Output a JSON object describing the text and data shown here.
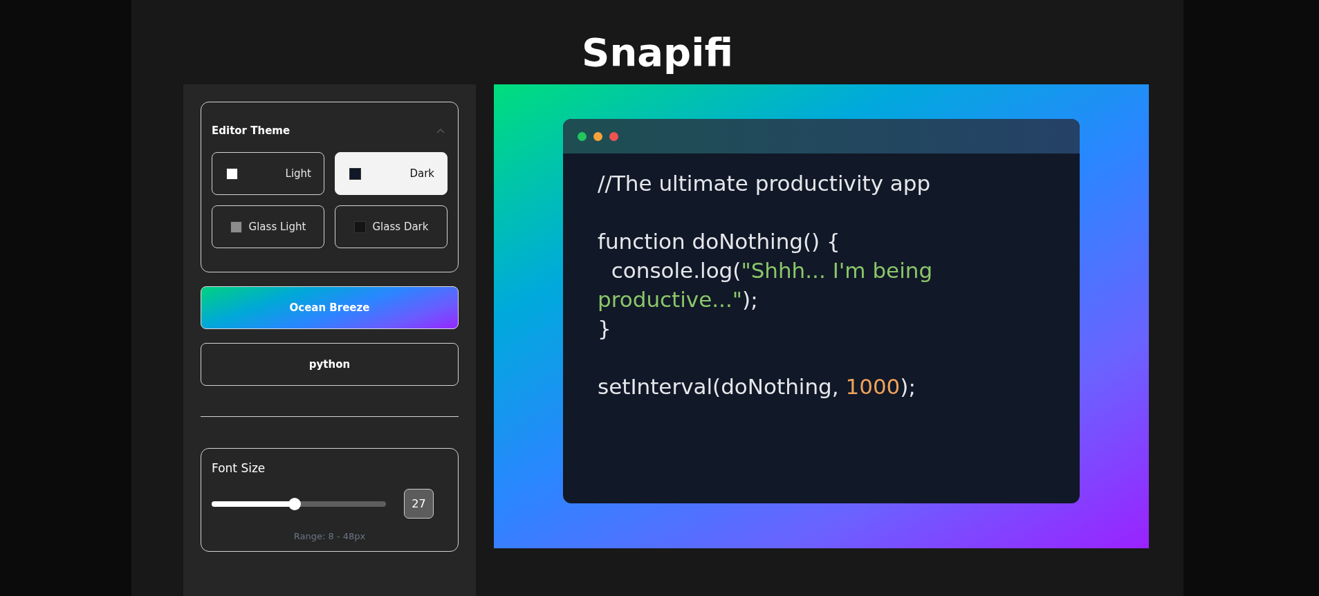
{
  "app_title": "Snapifi",
  "editor_theme": {
    "title": "Editor Theme",
    "expanded": true,
    "options": [
      {
        "label": "Light",
        "color": "#ffffff",
        "selected": false
      },
      {
        "label": "Dark",
        "color": "#111827",
        "selected": true
      },
      {
        "label": "Glass Light",
        "color": "#8c8c8c",
        "selected": false
      },
      {
        "label": "Glass Dark",
        "color": "#141414",
        "selected": false
      }
    ]
  },
  "background_button": {
    "label": "Ocean Breeze"
  },
  "language_button": {
    "label": "python"
  },
  "font_size": {
    "title": "Font Size",
    "level": 0.475,
    "value": "27",
    "range": "Range: 8 - 48px"
  },
  "code_blocks": [
    {
      "lines": [
        {
          "tokens": [
            {
              "kind": "plain",
              "text": "//The ultimate productivity app"
            }
          ]
        }
      ]
    },
    {
      "lines": [
        {
          "tokens": [
            {
              "kind": "plain",
              "text": "function doNothing() {"
            }
          ]
        },
        {
          "tokens": [
            {
              "kind": "plain",
              "text": "  console.log("
            },
            {
              "kind": "string",
              "text": "\"Shhh... I'm being productive...\""
            },
            {
              "kind": "plain",
              "text": ");"
            }
          ]
        },
        {
          "tokens": [
            {
              "kind": "plain",
              "text": "}"
            }
          ]
        }
      ]
    },
    {
      "lines": [
        {
          "tokens": [
            {
              "kind": "plain",
              "text": "setInterval(doNothing, "
            },
            {
              "kind": "number",
              "text": "1000"
            },
            {
              "kind": "plain",
              "text": ");"
            }
          ]
        }
      ]
    }
  ]
}
